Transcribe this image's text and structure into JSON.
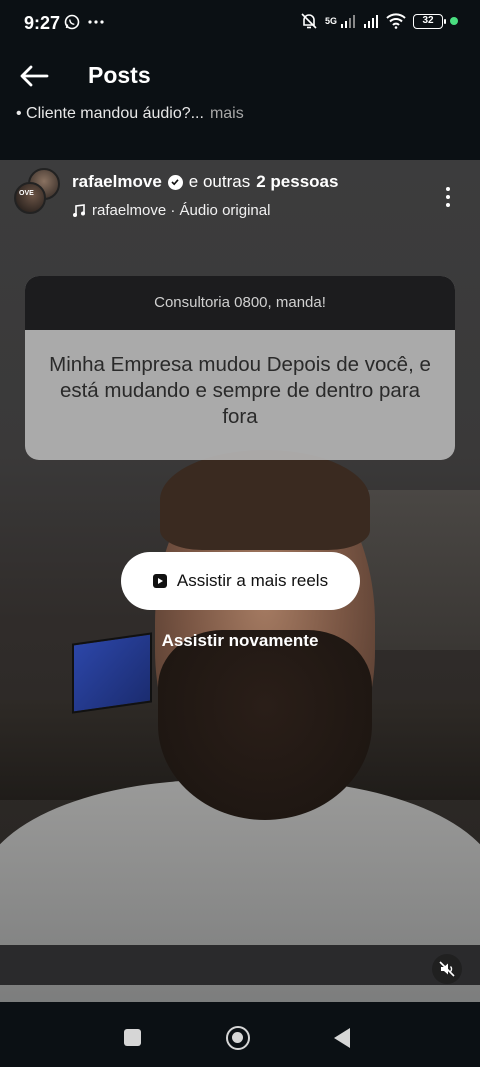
{
  "status_bar": {
    "time": "9:27",
    "network_label": "5G",
    "battery": "32",
    "icons": [
      "whatsapp-icon",
      "more-dots-icon",
      "mute-bell-icon",
      "signal-icon",
      "signal-icon",
      "wifi-icon",
      "battery-icon"
    ]
  },
  "header": {
    "title": "Posts",
    "back_icon": "arrow-left-icon"
  },
  "caption": {
    "text": "• Cliente mandou áudio?...",
    "more": "mais"
  },
  "post": {
    "author": "rafaelmove",
    "others_prefix": "e outras",
    "others_count": "2 pessoas",
    "audio_label": "rafaelmove · Áudio original",
    "avatar_text": "OVE"
  },
  "question_card": {
    "question": "Consultoria 0800, manda!",
    "answer": "Minha Empresa mudou Depois de você, e está mudando e sempre de dentro para fora"
  },
  "actions": {
    "watch_more": "Assistir a mais reels",
    "watch_again": "Assistir novamente"
  },
  "colors": {
    "background": "#0b1014",
    "card_header": "#1c1c1e",
    "battery_dot": "#4ade80"
  }
}
